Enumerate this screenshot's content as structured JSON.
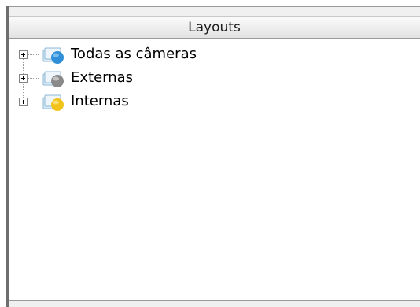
{
  "panel": {
    "title": "Layouts"
  },
  "tree": {
    "items": [
      {
        "label": "Todas as câmeras",
        "icon": "layout-blue-icon",
        "expanded": false
      },
      {
        "label": "Externas",
        "icon": "layout-gray-icon",
        "expanded": false
      },
      {
        "label": "Internas",
        "icon": "layout-yellow-icon",
        "expanded": false
      }
    ]
  },
  "colors": {
    "border": "#6e6e6e",
    "header_gradient_top": "#fbfbfb",
    "header_gradient_bottom": "#e2e2e2",
    "blue_icon": "#2f8fd8",
    "gray_icon": "#8a8a8a",
    "yellow_icon": "#f2c31a"
  }
}
